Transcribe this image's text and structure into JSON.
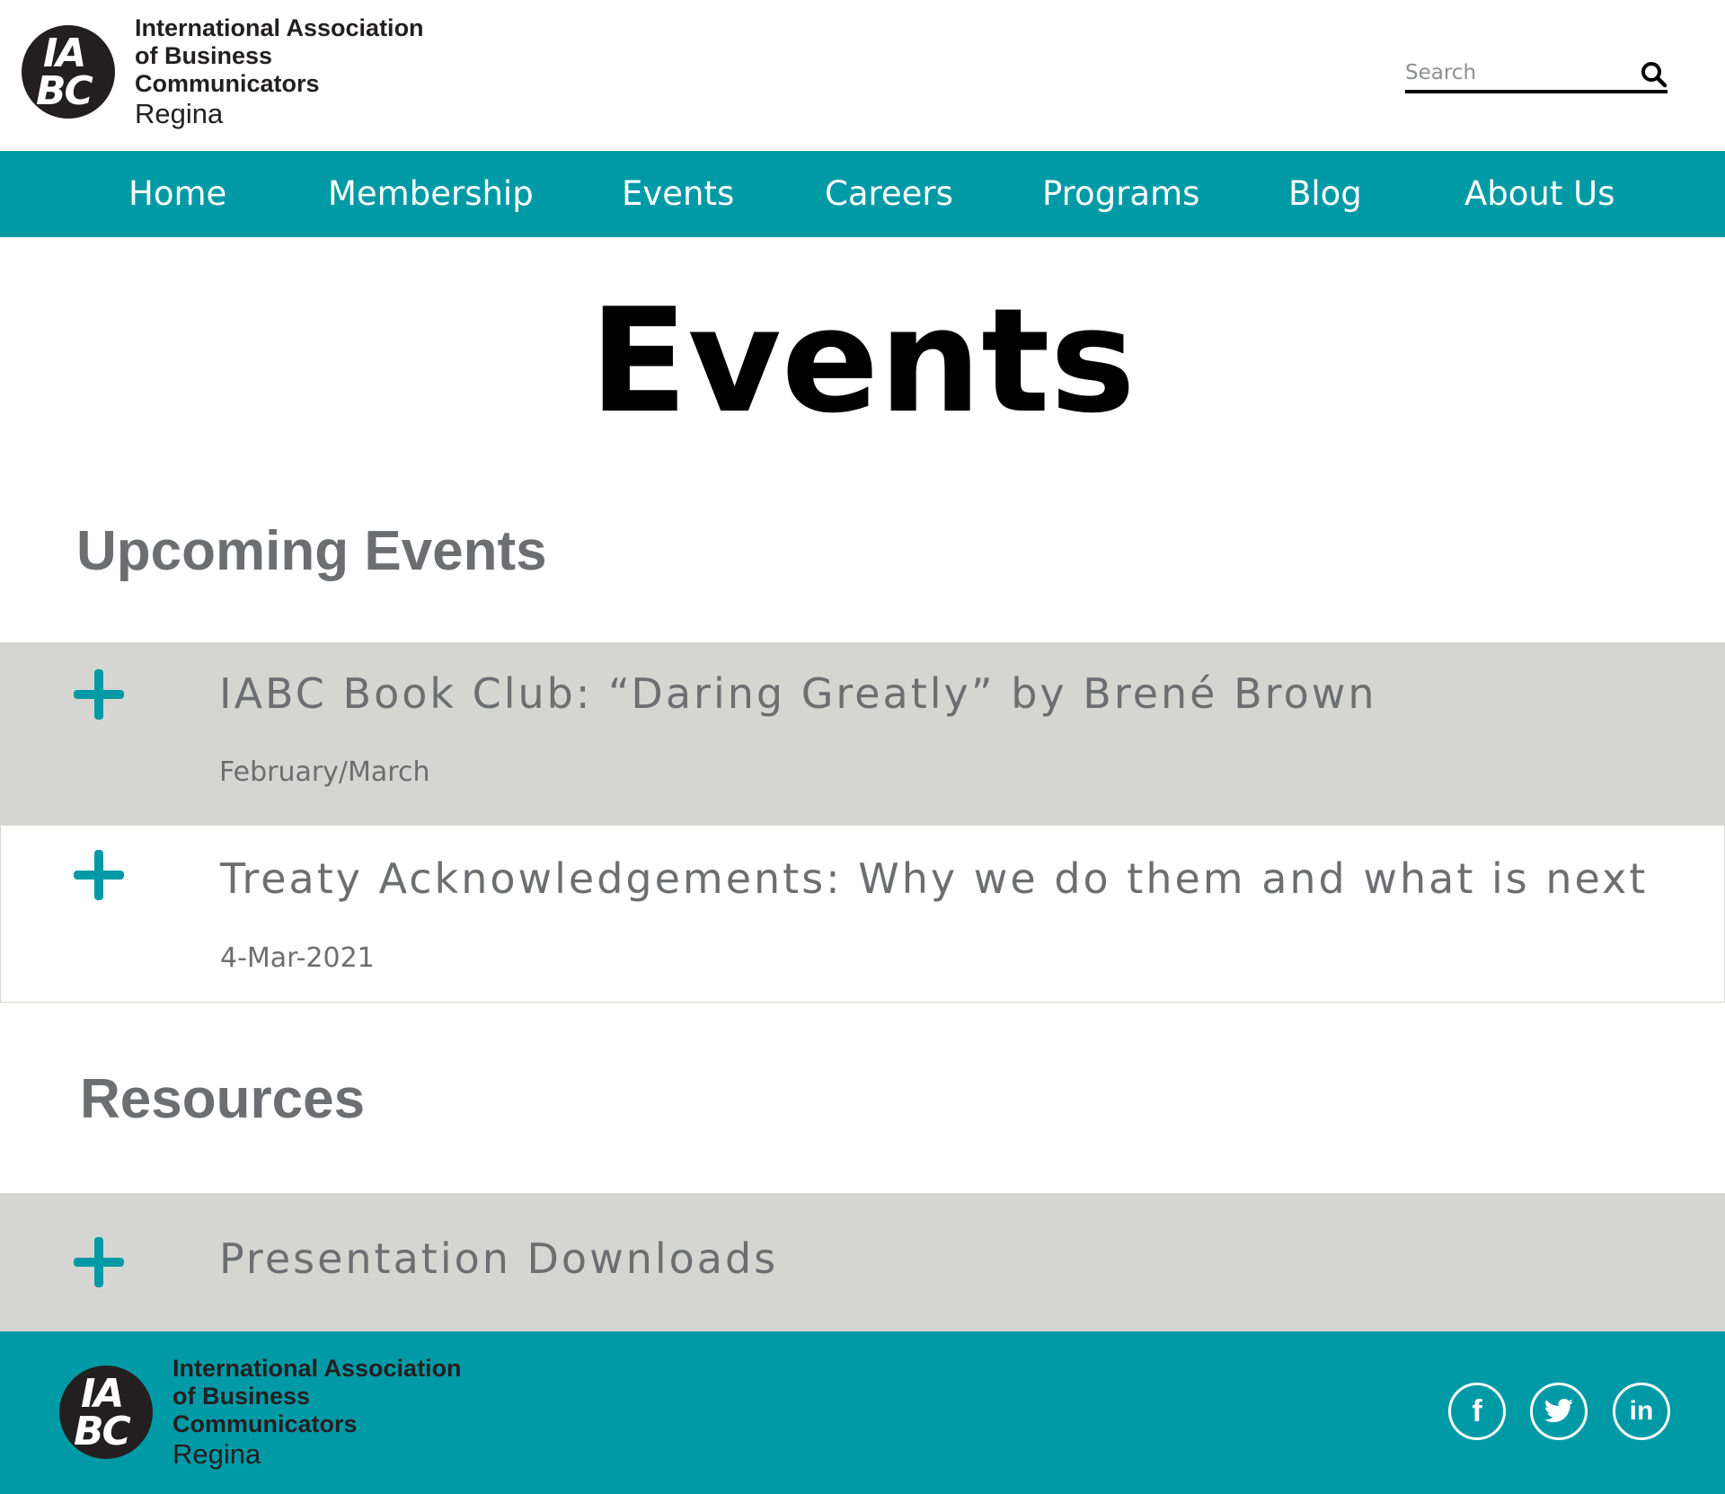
{
  "header": {
    "logo": {
      "mark_line1": "IA",
      "mark_line2": "BC",
      "line1": "International Association",
      "line2": "of Business Communicators",
      "line3": "Regina"
    },
    "search": {
      "placeholder": "Search",
      "icon": "search-icon"
    }
  },
  "nav": {
    "items": [
      {
        "label": "Home"
      },
      {
        "label": "Membership"
      },
      {
        "label": "Events"
      },
      {
        "label": "Careers"
      },
      {
        "label": "Programs"
      },
      {
        "label": "Blog"
      },
      {
        "label": "About Us"
      }
    ]
  },
  "main": {
    "title": "Events",
    "upcoming": {
      "heading": "Upcoming Events",
      "items": [
        {
          "title": "IABC Book Club: “Daring Greatly” by Brené Brown",
          "date": "February/March",
          "icon": "plus-icon"
        },
        {
          "title": "Treaty Acknowledgements: Why we do them and what is next",
          "date": "4-Mar-2021",
          "icon": "plus-icon"
        }
      ]
    },
    "resources": {
      "heading": "Resources",
      "items": [
        {
          "title": "Presentation Downloads",
          "icon": "plus-icon"
        }
      ]
    }
  },
  "footer": {
    "logo": {
      "mark_line1": "IA",
      "mark_line2": "BC",
      "line1": "International Association",
      "line2": "of Business Communicators",
      "line3": "Regina"
    },
    "social": [
      {
        "icon": "facebook-icon",
        "glyph": "f"
      },
      {
        "icon": "twitter-icon"
      },
      {
        "icon": "linkedin-icon",
        "glyph": "in"
      }
    ]
  },
  "colors": {
    "teal": "#009aa6",
    "accordion_grey": "#d5d5d1",
    "text_grey": "#6d6e71",
    "dark": "#231f20"
  }
}
